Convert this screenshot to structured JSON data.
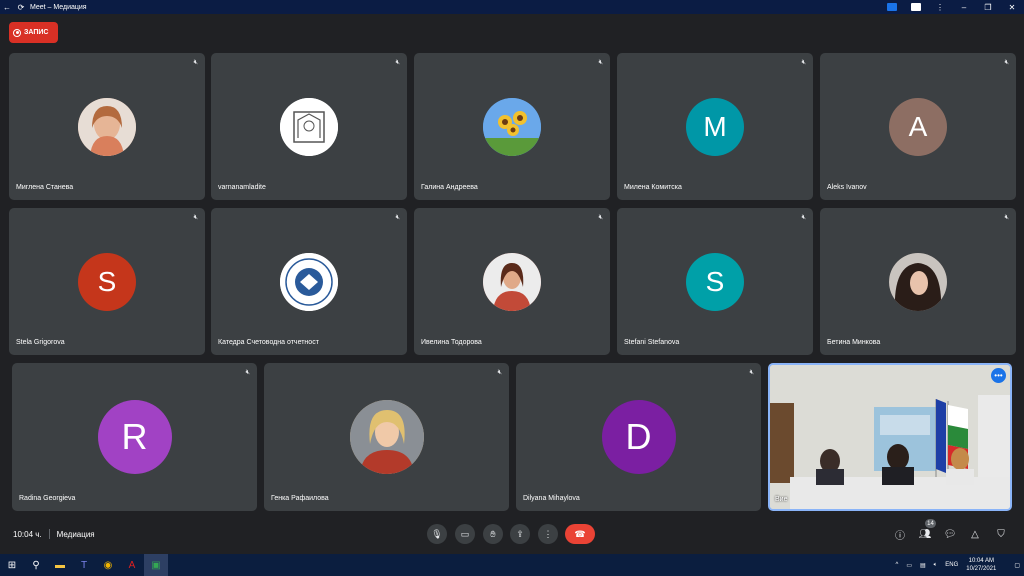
{
  "window": {
    "title": "Meet – Медиация",
    "back_icon": "arrow-left-icon",
    "reload_icon": "reload-icon"
  },
  "recording": {
    "label": "ЗАПИС"
  },
  "participants": [
    {
      "name": "Миглена Станева",
      "avatar": "photo",
      "avatar_color": "#c98a6e"
    },
    {
      "name": "varnanamladite",
      "avatar": "logo",
      "avatar_color": "#ffffff"
    },
    {
      "name": "Галина Андреева",
      "avatar": "sunflowers",
      "avatar_color": "#4a8fd8"
    },
    {
      "name": "Милена Комитска",
      "avatar": "M",
      "avatar_color": "#0097a7"
    },
    {
      "name": "Aleks Ivanov",
      "avatar": "A",
      "avatar_color": "#8d6e63"
    },
    {
      "name": "Stela Grigorova",
      "avatar": "S",
      "avatar_color": "#c5361b"
    },
    {
      "name": "Катедра Счетоводна отчетност",
      "avatar": "logo",
      "avatar_color": "#ffffff"
    },
    {
      "name": "Ивелина Тодорова",
      "avatar": "photo",
      "avatar_color": "#b84a3a"
    },
    {
      "name": "Stefani Stefanova",
      "avatar": "S",
      "avatar_color": "#00a0a8"
    },
    {
      "name": "Бетина Минкова",
      "avatar": "photo",
      "avatar_color": "#3a3330"
    },
    {
      "name": "Radina Georgieva",
      "avatar": "R",
      "avatar_color": "#a142c4"
    },
    {
      "name": "Генка Рафаилова",
      "avatar": "photo",
      "avatar_color": "#d9b37a"
    },
    {
      "name": "Dilyana Mihaylova",
      "avatar": "D",
      "avatar_color": "#7b1fa2"
    }
  ],
  "self_tile": {
    "label": "Вие"
  },
  "bottombar": {
    "time": "10:04 ч.",
    "meeting_name": "Медиация",
    "participant_count": "14"
  },
  "taskbar": {
    "lang": "ENG",
    "clock_time": "10:04 AM",
    "clock_date": "10/27/2021"
  }
}
